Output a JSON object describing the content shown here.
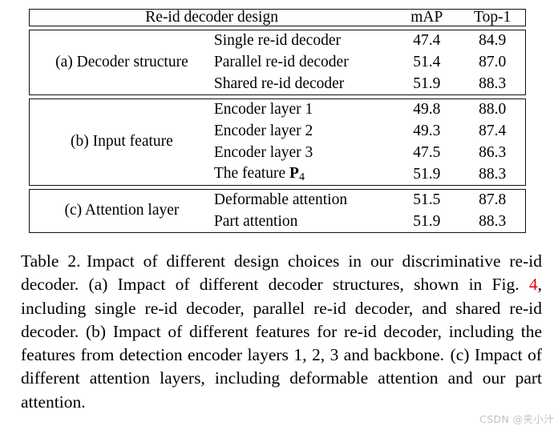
{
  "table": {
    "caption_id": "Table 2.",
    "columns": [
      "Re-id decoder design",
      "mAP",
      "Top-1"
    ],
    "header": {
      "design": "Re-id decoder design",
      "map": "mAP",
      "top1": "Top-1"
    },
    "sections": [
      {
        "label": "(a) Decoder structure",
        "rows": [
          {
            "item": "Single re-id decoder",
            "map": "47.4",
            "top1": "84.9"
          },
          {
            "item": "Parallel re-id decoder",
            "map": "51.4",
            "top1": "87.0"
          },
          {
            "item": "Shared re-id decoder",
            "map": "51.9",
            "top1": "88.3"
          }
        ]
      },
      {
        "label": "(b) Input feature",
        "rows": [
          {
            "item": "Encoder layer 1",
            "map": "49.8",
            "top1": "88.0"
          },
          {
            "item": "Encoder layer 2",
            "map": "49.3",
            "top1": "87.4"
          },
          {
            "item": "Encoder layer 3",
            "map": "47.5",
            "top1": "86.3"
          },
          {
            "item": "The feature P4",
            "item_prefix": "The feature ",
            "item_symbol": "P",
            "item_subscript": "4",
            "map": "51.9",
            "top1": "88.3"
          }
        ]
      },
      {
        "label": "(c) Attention layer",
        "rows": [
          {
            "item": "Deformable attention",
            "map": "51.5",
            "top1": "87.8"
          },
          {
            "item": "Part attention",
            "map": "51.9",
            "top1": "88.3"
          }
        ]
      }
    ]
  },
  "caption": {
    "part1": "Table 2.",
    "part2": "Impact of different design choices in our discriminative re-id decoder. (a) Impact of different decoder structures, shown in Fig.",
    "ref": "4",
    "part3": ", including single re-id decoder, parallel re-id decoder, and shared re-id decoder. (b) Impact of different features for re-id decoder, including the features from detection encoder layers 1, 2, 3 and backbone.",
    "part4": "(c) Impact of different attention layers, including deformable attention and our part attention."
  },
  "watermark": {
    "text": "CSDN @夹小汁"
  },
  "colors": {
    "ref_link": "#e8000d",
    "text": "#000000",
    "border": "#111111",
    "background": "#ffffff",
    "watermark": "#c3c3c3"
  }
}
